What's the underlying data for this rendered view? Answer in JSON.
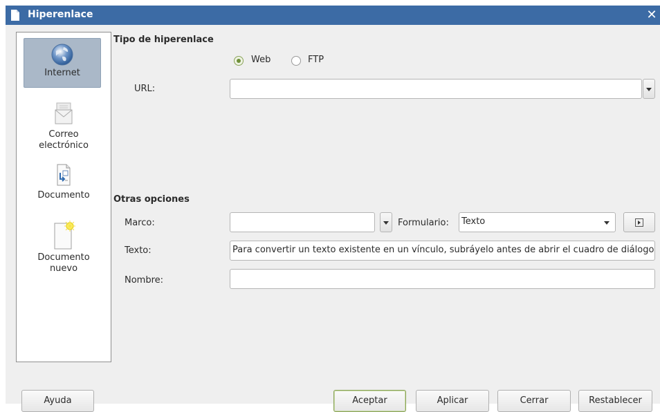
{
  "window": {
    "title": "Hiperenlace",
    "close_symbol": "✕"
  },
  "sidebar": {
    "items": [
      {
        "label": "Internet",
        "icon": "globe-icon",
        "selected": true
      },
      {
        "label": "Correo\nelectrónico",
        "icon": "mail-icon"
      },
      {
        "label": "Documento",
        "icon": "document-icon"
      },
      {
        "label": "Documento\nnuevo",
        "icon": "new-document-icon"
      }
    ]
  },
  "hyperlink_type": {
    "title": "Tipo de hiperenlace",
    "radio_web": "Web",
    "radio_ftp": "FTP",
    "selected": "Web",
    "url_label": "URL:",
    "url_value": ""
  },
  "other_options": {
    "title": "Otras opciones",
    "frame_label": "Marco:",
    "frame_value": "",
    "form_label": "Formulario:",
    "form_value": "Texto",
    "text_label": "Texto:",
    "text_value": "Para convertir un texto existente en un vínculo, subráyelo antes de abrir el cuadro de diálogo",
    "name_label": "Nombre:",
    "name_value": ""
  },
  "buttons": {
    "help": "Ayuda",
    "ok": "Aceptar",
    "apply": "Aplicar",
    "close": "Cerrar",
    "reset": "Restablecer"
  },
  "colors": {
    "titlebar": "#3c6ba5",
    "selected_item": "#aab8c8",
    "accent_green": "#8aa35a"
  }
}
